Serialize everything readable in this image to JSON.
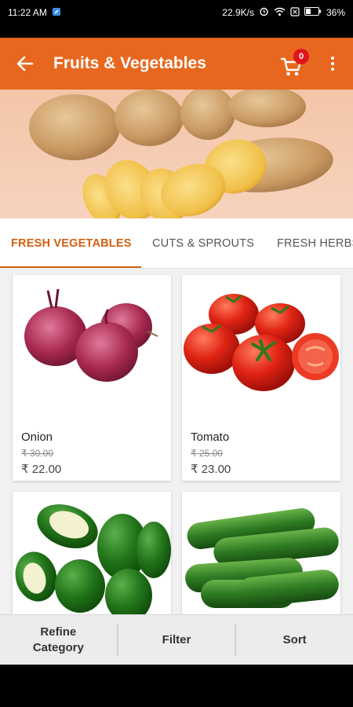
{
  "status_bar": {
    "time": "11:22 AM",
    "net_speed": "22.9K/s",
    "battery": "36%"
  },
  "app_bar": {
    "title": "Fruits & Vegetables",
    "cart_count": "0"
  },
  "tabs": [
    {
      "label": "FRESH VEGETABLES",
      "active": true
    },
    {
      "label": "CUTS & SPROUTS",
      "active": false
    },
    {
      "label": "FRESH HERBS",
      "active": false
    }
  ],
  "products": [
    {
      "name": "Onion",
      "mrp": "₹ 30.00",
      "price": "₹ 22.00",
      "image": "onion-image"
    },
    {
      "name": "Tomato",
      "mrp": "₹ 25.00",
      "price": "₹ 23.00",
      "image": "tomato-image"
    },
    {
      "name": "",
      "mrp": "",
      "price": "",
      "image": "capsicum-image"
    },
    {
      "name": "",
      "mrp": "",
      "price": "",
      "image": "cucumber-image"
    }
  ],
  "bottom_bar": {
    "refine_label_1": "Refine",
    "refine_label_2": "Category",
    "filter_label": "Filter",
    "sort_label": "Sort"
  },
  "colors": {
    "primary": "#e8671e",
    "accent": "#d35f12",
    "badge": "#e0141d"
  }
}
